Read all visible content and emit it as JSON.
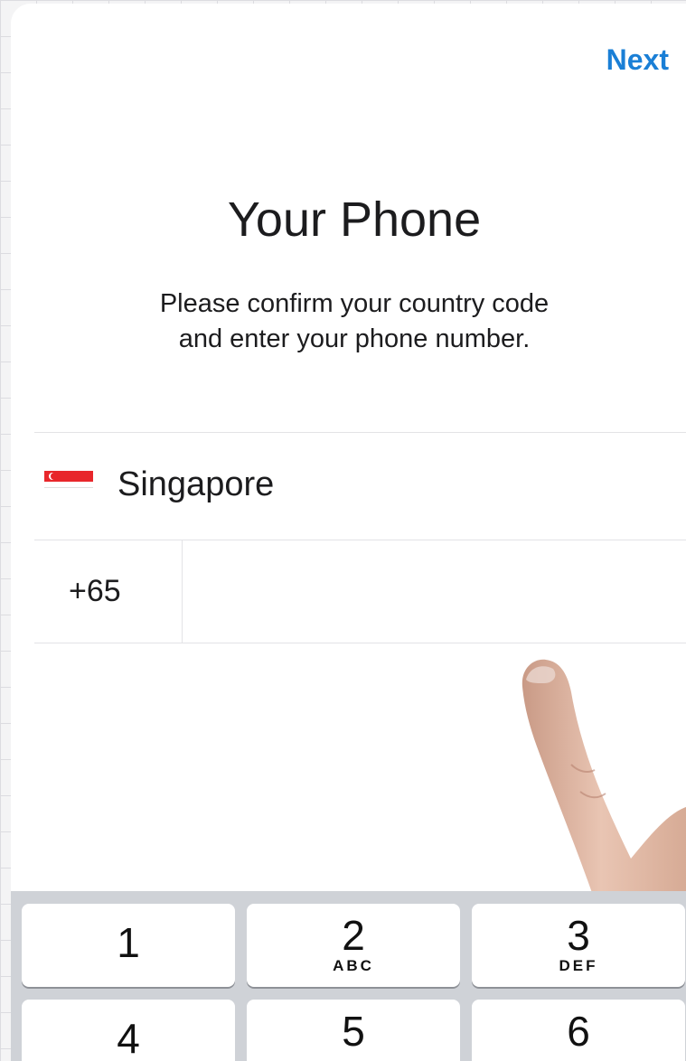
{
  "header": {
    "next_label": "Next"
  },
  "main": {
    "title": "Your Phone",
    "subtitle_line1": "Please confirm your country code",
    "subtitle_line2": "and enter your phone number."
  },
  "country": {
    "name": "Singapore",
    "flag_icon": "singapore-flag-icon"
  },
  "phone": {
    "country_code": "+65",
    "number": ""
  },
  "keypad": {
    "keys": [
      {
        "digit": "1",
        "letters": ""
      },
      {
        "digit": "2",
        "letters": "ABC"
      },
      {
        "digit": "3",
        "letters": "DEF"
      },
      {
        "digit": "4",
        "letters": ""
      },
      {
        "digit": "5",
        "letters": ""
      },
      {
        "digit": "6",
        "letters": ""
      }
    ]
  },
  "colors": {
    "accent": "#1a7fd6",
    "flag_red": "#e8272b",
    "keyboard_bg": "#cfd2d7"
  }
}
